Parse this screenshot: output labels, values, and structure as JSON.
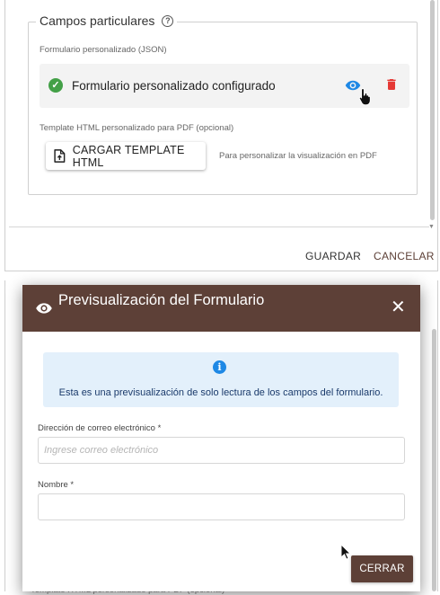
{
  "form_section": {
    "legend": "Campos particulares",
    "json_label": "Formulario personalizado (JSON)",
    "configured_text": "Formulario personalizado configurado",
    "template_label": "Template HTML personalizado para PDF (opcional)",
    "upload_button": "CARGAR TEMPLATE HTML",
    "upload_hint": "Para personalizar la visualización en PDF"
  },
  "footer": {
    "save": "GUARDAR",
    "cancel": "CANCELAR"
  },
  "dialog": {
    "title": "Previsualización del Formulario",
    "info_text": "Esta es una previsualización de solo lectura de los campos del formulario.",
    "fields": [
      {
        "label": "Dirección de correo electrónico *",
        "placeholder": "Ingrese correo electrónico",
        "value": ""
      },
      {
        "label": "Nombre *",
        "placeholder": "",
        "value": ""
      }
    ],
    "close_button": "CERRAR"
  },
  "background": {
    "obscured_text": "Template HTML personalizado para PDF (opcional)"
  },
  "colors": {
    "primary_brown": "#5d4037",
    "success_green": "#43a047",
    "eye_blue": "#1e88e5",
    "delete_red": "#e53935",
    "info_bg": "#e3f0fb"
  },
  "icons": {
    "help": "help-circle-icon",
    "check": "check-circle-icon",
    "preview": "eye-icon",
    "delete": "trash-icon",
    "upload": "file-upload-icon",
    "info": "info-icon",
    "close": "close-icon"
  }
}
